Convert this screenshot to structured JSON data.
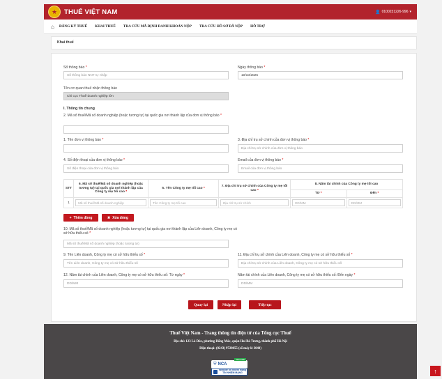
{
  "header": {
    "brand": "THUẾ VIỆT NAM",
    "user_id": "0100231226-996"
  },
  "nav": {
    "items": [
      "ĐĂNG KÝ THUẾ",
      "KHAI THUẾ",
      "TRA CỨU MÃ ĐỊNH DANH KHOẢN NỘP",
      "TRA CỨU HỒ SƠ ĐÃ NỘP",
      "HỖ TRỢ"
    ]
  },
  "page": {
    "title": "Khai thuế"
  },
  "form": {
    "so_thong_bao": {
      "label": "Số thông báo",
      "placeholder": "Số thông báo NNT tự nhập"
    },
    "ngay_thong_bao": {
      "label": "Ngày thông báo",
      "value": "10/10/2025"
    },
    "co_quan_thue": {
      "label": "Tên cơ quan thuế nhận thông báo",
      "value": "Chi cục Thuế doanh nghiệp lớn"
    },
    "section1": "I. Thông tin chung",
    "field2": {
      "label": "2. Mã số thuế/Mã số doanh nghiệp (hoặc tương tự) tại quốc gia nơi thành lập của đơn vị thông báo"
    },
    "field1": {
      "label": "1. Tên đơn vị thông báo"
    },
    "field3": {
      "label": "3. Địa chỉ trụ sở chính của đơn vị thông báo",
      "placeholder": "Địa chỉ trụ sở chính của đơn vị thông báo"
    },
    "field4": {
      "label": "4. Số điện thoại của đơn vị thông báo",
      "placeholder": "Số điện thoại của đơn vị thông báo"
    },
    "email": {
      "label": "Email của đơn vị thông báo",
      "placeholder": "Email của đơn vị thông báo"
    },
    "table": {
      "headers": {
        "stt": "STT",
        "col6": "6. Mã số thuế/Mã số doanh nghiệp (hoặc tương tự) tại quốc gia nơi thành lập của Công ty mẹ tối cao",
        "col5": "5. Tên Công ty mẹ tối cao",
        "col7": "7. Địa chỉ trụ sở chính của Công ty mẹ tối cao",
        "col8": "8. Năm tài chính của Công ty mẹ tối cao",
        "tu": "Từ",
        "den": "Đến"
      },
      "rows": [
        {
          "stt": "1",
          "mst": "Mã số thuế/Mã số doanh nghiệp",
          "ten": "Tên Công ty mẹ tối cao",
          "diachi": "Địa chỉ trụ sở chính",
          "tu": "DD/MM",
          "den": "DD/MM"
        }
      ]
    },
    "btn_add": "Thêm dòng",
    "btn_delete": "Xóa dòng",
    "field10": {
      "label": "10. Mã số thuế/Mã số doanh nghiệp (hoặc tương tự) tại quốc gia nơi thành lập của Liên doanh, Công ty mẹ có sở hữu thiểu số",
      "placeholder": "Mã số thuế/Mã số doanh nghiệp (hoặc tương tự)"
    },
    "field9": {
      "label": "9. Tên Liên doanh, Công ty mẹ có sở hữu thiểu số",
      "placeholder": "Tên Liên doanh, Công ty mẹ có sở hữu thiểu số"
    },
    "field11": {
      "label": "11. Địa chỉ trụ sở chính của Liên doanh, Công ty mẹ có sở hữu thiểu số",
      "placeholder": "Địa chỉ trụ sở chính của Liên doanh, Công ty mẹ có sở hữu thiểu số"
    },
    "field12": {
      "label": "12. Năm tài chính của Liên doanh, Công ty mẹ có sở hữu thiểu số: Từ ngày",
      "placeholder": "DD/MM"
    },
    "field12b": {
      "label": "Năm tài chính của Liên doanh, Công ty mẹ có sở hữu thiểu số: Đến ngày",
      "placeholder": "DD/MM"
    }
  },
  "actions": {
    "back": "Quay lại",
    "reenter": "Nhập lại",
    "next": "Tiếp tục"
  },
  "footer": {
    "title": "Thuế Việt Nam - Trang thông tin điện tử của Tổng cục Thuế",
    "address": "Địa chỉ: 123 Lò Đúc, phường Đống Mác, quận Hai Bà Trưng, thành phố Hà Nội",
    "phone": "Điện thoại: (0243) 9728055 (số máy lẻ 3040)",
    "nca": "NCA",
    "nca_tag": "SECURE",
    "trust_line1": "Website tín nhiệm mạng",
    "trust_line2": "TÍN NHIỆM MẠNG"
  },
  "colors": {
    "brand_red": "#b2232c",
    "button_red": "#c2191f",
    "footer_bg": "#4a4748"
  }
}
